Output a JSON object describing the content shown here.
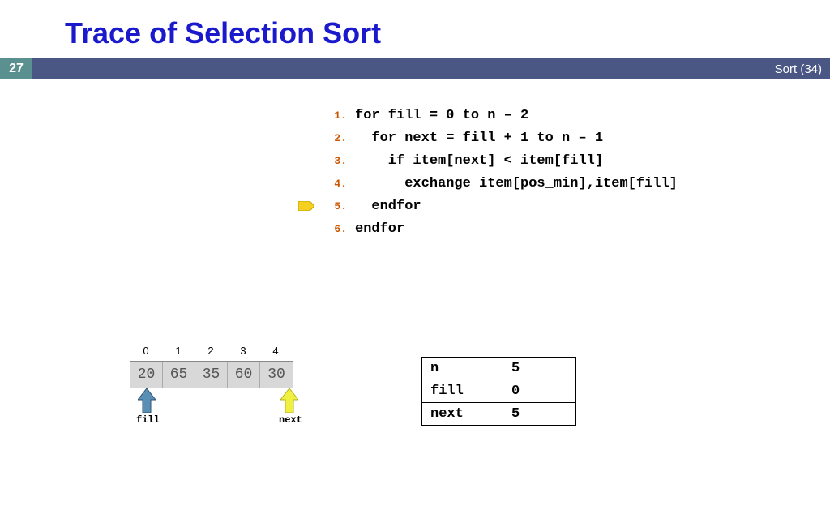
{
  "title": "Trace of Selection Sort",
  "slide_number": "27",
  "bar_right": "Sort (34)",
  "code": {
    "lines": [
      {
        "num": "1.",
        "text": "for fill = 0 to n – 2",
        "marker": false
      },
      {
        "num": "2.",
        "text": "  for next = fill + 1 to n – 1",
        "marker": false
      },
      {
        "num": "3.",
        "text": "    if item[next] < item[fill]",
        "marker": false
      },
      {
        "num": "4.",
        "text": "      exchange item[pos_min],item[fill]",
        "marker": false
      },
      {
        "num": "5.",
        "text": "  endfor",
        "marker": true
      },
      {
        "num": "6.",
        "text": "endfor",
        "marker": false
      }
    ]
  },
  "array": {
    "indices": [
      "0",
      "1",
      "2",
      "3",
      "4"
    ],
    "values": [
      "20",
      "65",
      "35",
      "60",
      "30"
    ],
    "fill_label": "fill",
    "next_label": "next"
  },
  "table": {
    "rows": [
      [
        "n",
        "5"
      ],
      [
        "fill",
        "0"
      ],
      [
        "next",
        "5"
      ]
    ]
  }
}
